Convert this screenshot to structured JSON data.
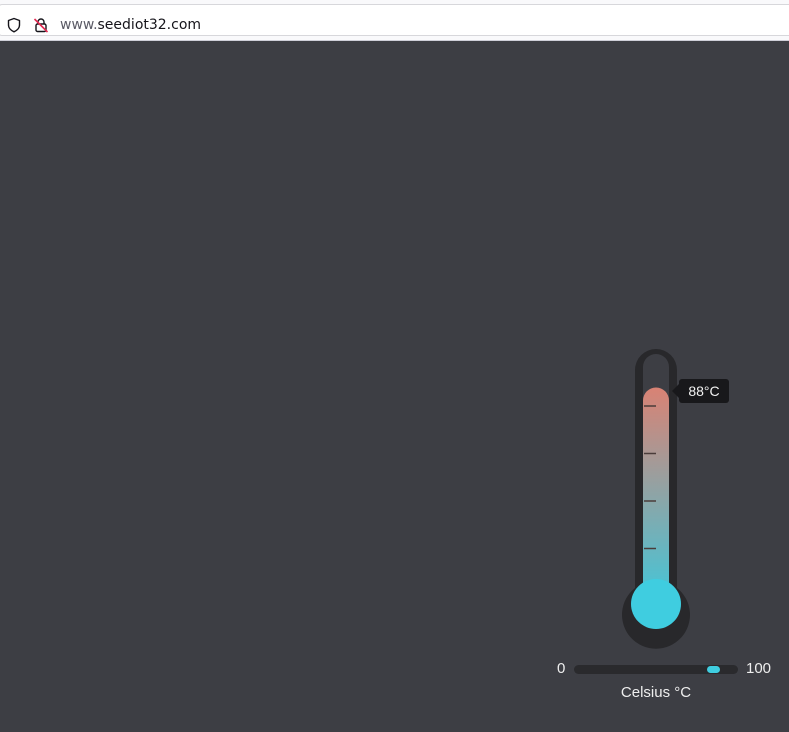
{
  "browser": {
    "url_prefix": "www.",
    "url_domain": "seediot32.com"
  },
  "thermometer": {
    "value": 88,
    "value_label": "88°C",
    "min": 0,
    "max": 100,
    "min_label": "0",
    "max_label": "100",
    "unit_label": "Celsius °C",
    "tick_count": 4,
    "colors": {
      "hot": "#d98274",
      "cold": "#41c7da",
      "bulb": "#3fcde0",
      "tube_outline": "#28282b",
      "background": "#3d3e44"
    }
  },
  "slider": {
    "value": 88
  }
}
